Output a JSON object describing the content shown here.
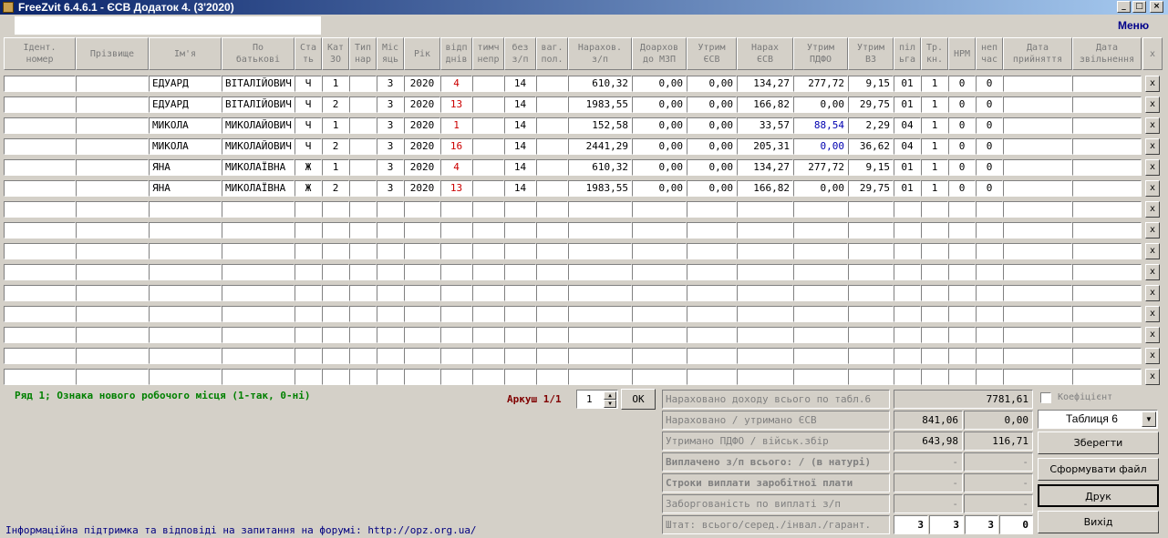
{
  "window": {
    "title": "FreeZvit 6.4.6.1 - ЄСВ Додаток 4. (3'2020)"
  },
  "menu_label": "Меню",
  "headers": [
    "Ідент.\nномер",
    "Прізвище",
    "Ім'я",
    "По\nбатькові",
    "Ста\nть",
    "Кат\nЗО",
    "Тип\nнар",
    "Міс\nяць",
    "Рік",
    "відп\nднів",
    "тимч\nнепр",
    "без\nз/п",
    "ваг.\nпол.",
    "Нарахов.\nз/п",
    "Доархов\nдо МЗП",
    "Утрим\nЄСВ",
    "Нарах\nЄСВ",
    "Утрим\nПДФО",
    "Утрим\nВЗ",
    "піл\nьга",
    "Тр.\nкн.",
    "НРМ",
    "неп\nчас",
    "Дата\nприйняття",
    "Дата\nзвільнення",
    "x"
  ],
  "rows": [
    {
      "name": "",
      "surname": "",
      "first": "ЕДУАРД",
      "patronymic": "ВІТАЛІЙОВИЧ",
      "sex": "Ч",
      "cat": "1",
      "type": "",
      "month": "3",
      "year": "2020",
      "vac": "4",
      "tmp": "",
      "nopay": "14",
      "preg": "",
      "accrued": "610,32",
      "topup": "0,00",
      "esv_ret": "0,00",
      "esv_acc": "134,27",
      "pdfo": "277,72",
      "vz": "9,15",
      "lgota": "01",
      "trkn": "1",
      "nrm": "0",
      "nepchas": "0",
      "hire": "",
      "fire": "",
      "x": "x"
    },
    {
      "name": "",
      "surname": "",
      "first": "ЕДУАРД",
      "patronymic": "ВІТАЛІЙОВИЧ",
      "sex": "Ч",
      "cat": "2",
      "type": "",
      "month": "3",
      "year": "2020",
      "vac": "13",
      "tmp": "",
      "nopay": "14",
      "preg": "",
      "accrued": "1983,55",
      "topup": "0,00",
      "esv_ret": "0,00",
      "esv_acc": "166,82",
      "pdfo": "0,00",
      "vz": "29,75",
      "lgota": "01",
      "trkn": "1",
      "nrm": "0",
      "nepchas": "0",
      "hire": "",
      "fire": "",
      "x": "x"
    },
    {
      "name": "",
      "surname": "",
      "first": "МИКОЛА",
      "patronymic": "МИКОЛАЙОВИЧ",
      "sex": "Ч",
      "cat": "1",
      "type": "",
      "month": "3",
      "year": "2020",
      "vac": "1",
      "tmp": "",
      "nopay": "14",
      "preg": "",
      "accrued": "152,58",
      "topup": "0,00",
      "esv_ret": "0,00",
      "esv_acc": "33,57",
      "pdfo": "88,54",
      "vz": "2,29",
      "lgota": "04",
      "trkn": "1",
      "nrm": "0",
      "nepchas": "0",
      "hire": "",
      "fire": "",
      "x": "x"
    },
    {
      "name": "",
      "surname": "",
      "first": "МИКОЛА",
      "patronymic": "МИКОЛАЙОВИЧ",
      "sex": "Ч",
      "cat": "2",
      "type": "",
      "month": "3",
      "year": "2020",
      "vac": "16",
      "tmp": "",
      "nopay": "14",
      "preg": "",
      "accrued": "2441,29",
      "topup": "0,00",
      "esv_ret": "0,00",
      "esv_acc": "205,31",
      "pdfo": "0,00",
      "vz": "36,62",
      "lgota": "04",
      "trkn": "1",
      "nrm": "0",
      "nepchas": "0",
      "hire": "",
      "fire": "",
      "x": "x"
    },
    {
      "name": "",
      "surname": "",
      "first": "ЯНА",
      "patronymic": "МИКОЛАЇВНА",
      "sex": "Ж",
      "cat": "1",
      "type": "",
      "month": "3",
      "year": "2020",
      "vac": "4",
      "tmp": "",
      "nopay": "14",
      "preg": "",
      "accrued": "610,32",
      "topup": "0,00",
      "esv_ret": "0,00",
      "esv_acc": "134,27",
      "pdfo": "277,72",
      "vz": "9,15",
      "lgota": "01",
      "trkn": "1",
      "nrm": "0",
      "nepchas": "0",
      "hire": "",
      "fire": "",
      "x": "x"
    },
    {
      "name": "",
      "surname": "",
      "first": "ЯНА",
      "patronymic": "МИКОЛАЇВНА",
      "sex": "Ж",
      "cat": "2",
      "type": "",
      "month": "3",
      "year": "2020",
      "vac": "13",
      "tmp": "",
      "nopay": "14",
      "preg": "",
      "accrued": "1983,55",
      "topup": "0,00",
      "esv_ret": "0,00",
      "esv_acc": "166,82",
      "pdfo": "0,00",
      "vz": "29,75",
      "lgota": "01",
      "trkn": "1",
      "nrm": "0",
      "nepchas": "0",
      "hire": "",
      "fire": "",
      "x": "x"
    }
  ],
  "empty_x": "x",
  "status_text": "Ряд 1; Ознака нового робочого місця (1-так, 0-ні)",
  "info_text": "Інформаційна підтримка та відповіді на запитання на форумі: http://opz.org.ua/",
  "sheet_label": "Аркуш 1/1",
  "sheet_value": "1",
  "ok_label": "ОК",
  "summary": [
    {
      "label": "Нараховано доходу всього по табл.6",
      "bold": false,
      "v1": "7781,61"
    },
    {
      "label": "Нараховано / утримано ЄСВ",
      "bold": false,
      "v1": "841,06",
      "v2": "0,00"
    },
    {
      "label": "Утримано ПДФО / військ.збір",
      "bold": false,
      "v1": "643,98",
      "v2": "116,71"
    },
    {
      "label": "Виплачено з/п всього: / (в натурі)",
      "bold": true,
      "v1": "-",
      "v2": "-"
    },
    {
      "label": "Строки виплати заробітної плати",
      "bold": true,
      "v1": "-",
      "v2": "-"
    },
    {
      "label": "Заборгованість по виплаті з/п",
      "bold": false,
      "v1": "-",
      "v2": "-"
    },
    {
      "label": "Штат: всього/серед./інвал./гарант.",
      "bold": false,
      "vals": [
        "3",
        "3",
        "3",
        "0"
      ]
    }
  ],
  "coef_label": "Коефіцієнт",
  "table_select": "Таблиця 6",
  "buttons": {
    "save": "Зберегти",
    "generate": "Сформувати файл",
    "print": "Друк",
    "exit": "Вихід"
  }
}
